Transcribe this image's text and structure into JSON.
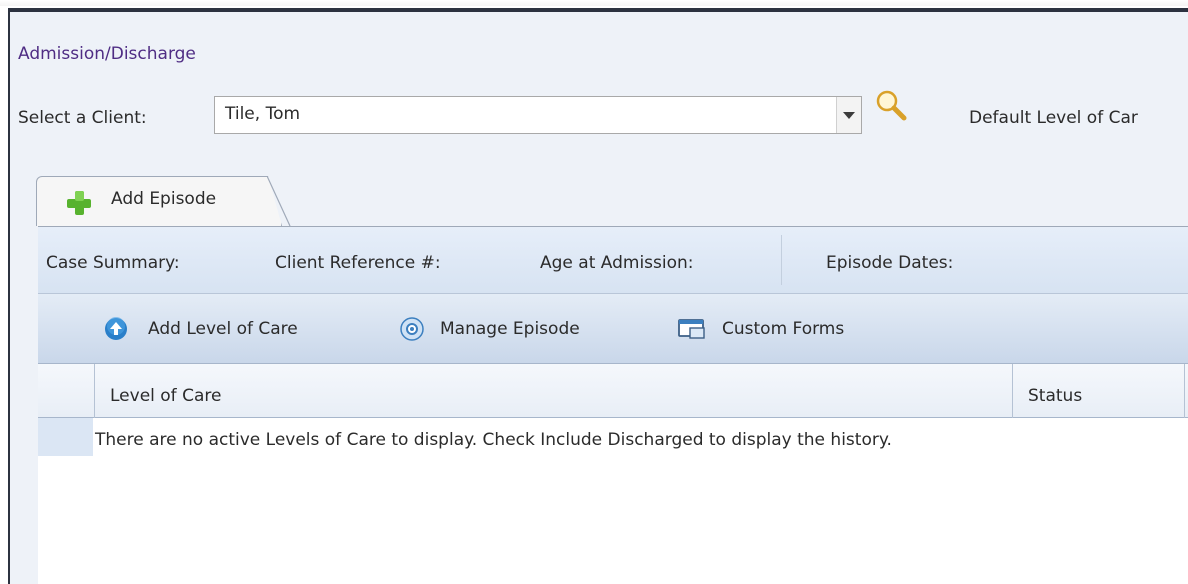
{
  "window": {
    "title": "Admission/Discharge"
  },
  "client": {
    "select_label": "Select a Client:",
    "value": "Tile, Tom",
    "default_label": "Default Level of Car"
  },
  "tabs": [
    {
      "label": "Add Episode",
      "icon": "green-plus-icon"
    }
  ],
  "summary": {
    "case_summary": "Case Summary:",
    "client_reference": "Client Reference #:",
    "age_at_admission": "Age at Admission:",
    "episode_dates": "Episode Dates:"
  },
  "toolbar": {
    "add_level": "Add Level of Care",
    "manage_episode": "Manage Episode",
    "custom_forms": "Custom Forms"
  },
  "grid": {
    "columns": [
      "Level of Care",
      "Status"
    ],
    "empty_message": "There are no active Levels of Care to display. Check Include Discharged to display the history."
  },
  "colors": {
    "title": "#4f2d84",
    "accent_blue": "#2a7fc9",
    "green": "#57b22e"
  }
}
